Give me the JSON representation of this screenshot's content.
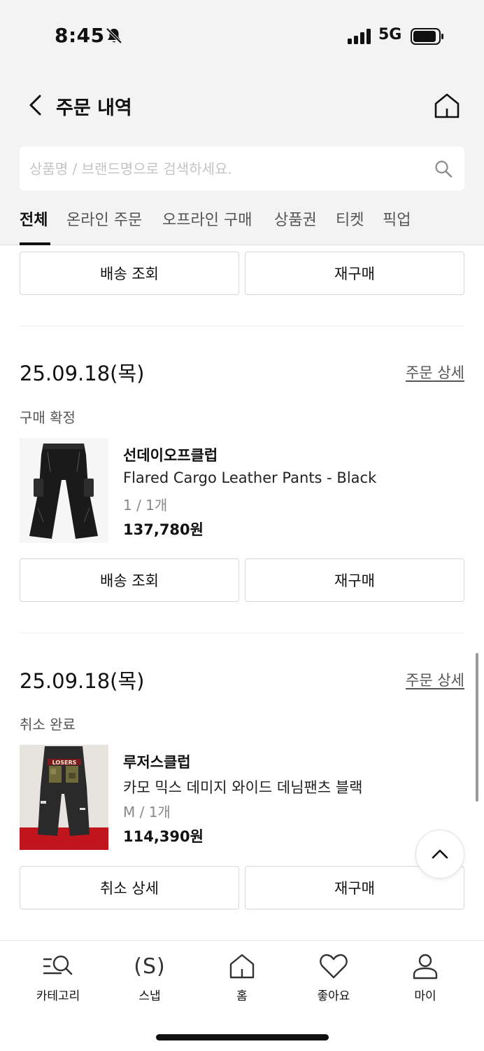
{
  "status_bar": {
    "time": "8:45",
    "network": "5G"
  },
  "header": {
    "title": "주문 내역"
  },
  "search": {
    "placeholder": "상품명 / 브랜드명으로 검색하세요."
  },
  "tabs": [
    {
      "label": "전체",
      "active": true
    },
    {
      "label": "온라인 주문",
      "active": false
    },
    {
      "label": "오프라인 구매",
      "active": false
    },
    {
      "label": "상품권",
      "active": false
    },
    {
      "label": "티켓",
      "active": false
    },
    {
      "label": "픽업",
      "active": false
    }
  ],
  "previous_order": {
    "actions": [
      "배송 조회",
      "재구매"
    ]
  },
  "orders": [
    {
      "date": "25.09.18(목)",
      "detail_link": "주문 상세",
      "status": "구매 확정",
      "brand": "선데이오프클럽",
      "product_name": "Flared Cargo Leather Pants - Black",
      "option": "1 / 1개",
      "price": "137,780원",
      "actions": [
        "배송 조회",
        "재구매"
      ]
    },
    {
      "date": "25.09.18(목)",
      "detail_link": "주문 상세",
      "status": "취소 완료",
      "brand": "루저스클럽",
      "product_name": "카모 믹스 데미지 와이드 데님팬츠 블랙",
      "option": "M / 1개",
      "price": "114,390원",
      "image_text": "LOSERS",
      "actions": [
        "취소 상세",
        "재구매"
      ]
    }
  ],
  "bottom_nav": [
    {
      "label": "카테고리",
      "icon": "category-search-icon"
    },
    {
      "label": "스냅",
      "icon": "snap-icon",
      "glyph": "(S)"
    },
    {
      "label": "홈",
      "icon": "home-icon"
    },
    {
      "label": "좋아요",
      "icon": "heart-icon"
    },
    {
      "label": "마이",
      "icon": "person-icon"
    }
  ]
}
